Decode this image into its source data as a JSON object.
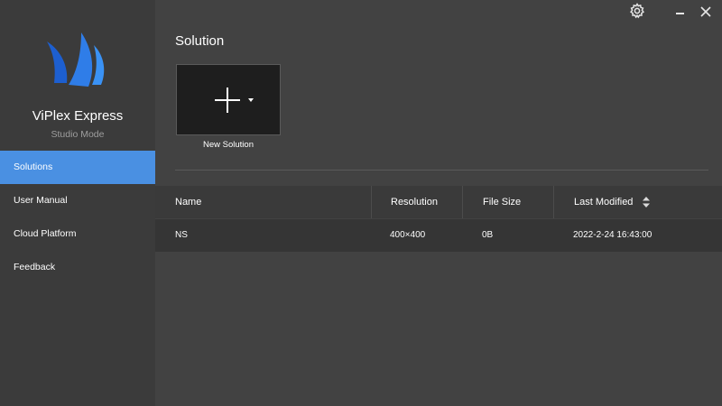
{
  "sidebar": {
    "app_name": "ViPlex Express",
    "app_mode": "Studio Mode",
    "logo_icon": "viplex-sail-logo",
    "items": [
      {
        "label": "Solutions",
        "active": true
      },
      {
        "label": "User Manual",
        "active": false
      },
      {
        "label": "Cloud Platform",
        "active": false
      },
      {
        "label": "Feedback",
        "active": false
      }
    ]
  },
  "header": {
    "title": "Solution",
    "icons": [
      "gear-icon",
      "minimize-icon",
      "close-icon"
    ]
  },
  "new_solution": {
    "label": "New Solution",
    "icon": "plus-icon"
  },
  "table": {
    "columns": [
      "Name",
      "Resolution",
      "File Size",
      "Last Modified"
    ],
    "sort_icon": "sort-icon",
    "rows": [
      {
        "name": "NS",
        "resolution": "400×400",
        "file_size": "0B",
        "last_modified": "2022-2-24 16:43:00"
      }
    ]
  },
  "colors": {
    "accent": "#4a90e2",
    "sidebar_bg": "#3b3b3b",
    "main_bg": "#424242",
    "tile_bg": "#1e1e1e"
  }
}
